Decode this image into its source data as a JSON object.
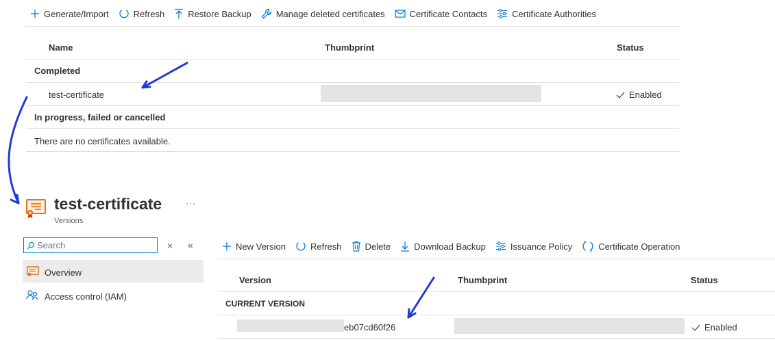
{
  "top_toolbar": {
    "generate": "Generate/Import",
    "refresh": "Refresh",
    "restore": "Restore Backup",
    "manage_deleted": "Manage deleted certificates",
    "contacts": "Certificate Contacts",
    "authorities": "Certificate Authorities"
  },
  "cert_table": {
    "headers": {
      "name": "Name",
      "thumbprint": "Thumbprint",
      "status": "Status"
    },
    "group_completed": "Completed",
    "row_name": "test-certificate",
    "row_status": "Enabled",
    "group_inprogress": "In progress, failed or cancelled",
    "empty_text": "There are no certificates available."
  },
  "detail": {
    "title": "test-certificate",
    "more": "···",
    "subtitle": "Versions",
    "search_placeholder": "Search",
    "clear": "×",
    "collapse": "«",
    "nav": {
      "overview": "Overview",
      "iam": "Access control (IAM)"
    },
    "toolbar": {
      "new_version": "New Version",
      "refresh": "Refresh",
      "delete": "Delete",
      "download": "Download Backup",
      "issuance": "Issuance Policy",
      "operation": "Certificate Operation"
    },
    "table": {
      "headers": {
        "version": "Version",
        "thumbprint": "Thumbprint",
        "status": "Status"
      },
      "group": "CURRENT VERSION",
      "version_suffix": "eb07cd60f26",
      "status": "Enabled"
    }
  },
  "colors": {
    "accent": "#0078d4",
    "arrow": "#1f3bd6",
    "cert_orange": "#e8731a"
  }
}
